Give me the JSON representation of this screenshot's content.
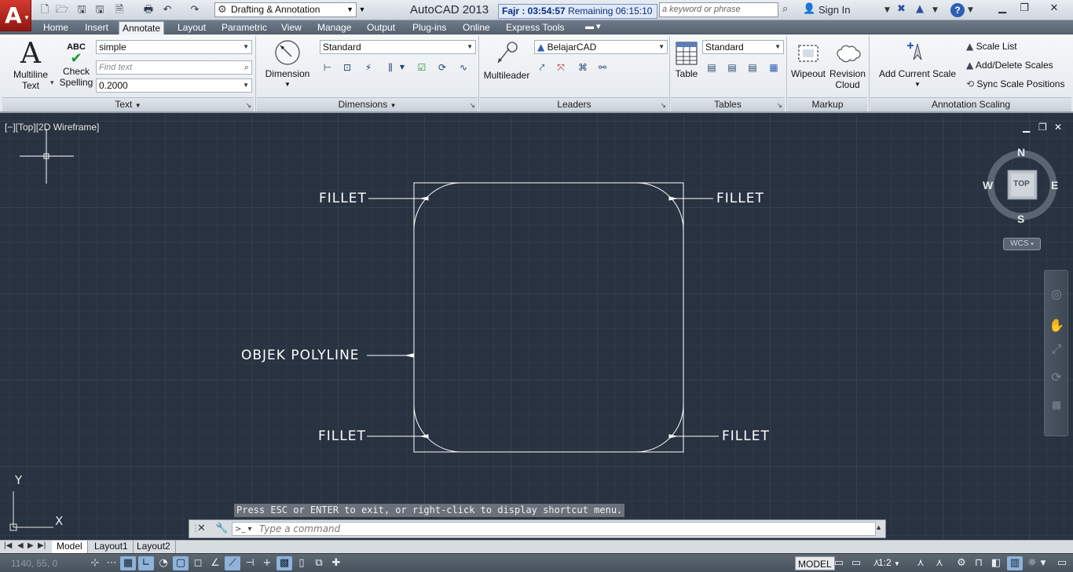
{
  "titlebar": {
    "app_title": "AutoCAD 2013",
    "workspace": "Drafting & Annotation",
    "prayer_label": "Fajr : 03:54:57",
    "prayer_remaining": "Remaining 06:15:10",
    "search_placeholder": "a keyword or phrase",
    "signin": "Sign In",
    "help_label": "?"
  },
  "tabs": [
    "Home",
    "Insert",
    "Annotate",
    "Layout",
    "Parametric",
    "View",
    "Manage",
    "Output",
    "Plug-ins",
    "Online",
    "Express Tools"
  ],
  "active_tab": "Annotate",
  "ribbon": {
    "text_panel": {
      "multiline_text": [
        "Multiline",
        "Text"
      ],
      "check_spelling": [
        "Check",
        "Spelling"
      ],
      "abc": "ABC",
      "text_style": "simple",
      "find_placeholder": "Find text",
      "text_height": "0.2000",
      "footer": "Text"
    },
    "dimensions_panel": {
      "dimension": "Dimension",
      "dim_style": "Standard",
      "footer": "Dimensions"
    },
    "leaders_panel": {
      "multileader": "Multileader",
      "leader_style": "BelajarCAD",
      "footer": "Leaders"
    },
    "tables_panel": {
      "table": "Table",
      "table_style": "Standard",
      "footer": "Tables"
    },
    "markup_panel": {
      "wipeout": "Wipeout",
      "revision_cloud": [
        "Revision",
        "Cloud"
      ],
      "footer": "Markup"
    },
    "annotation_scaling_panel": {
      "add_current_scale": "Add Current Scale",
      "scale_list": "Scale List",
      "add_delete_scales": "Add/Delete Scales",
      "sync_scale_positions": "Sync Scale Positions",
      "footer": "Annotation Scaling"
    }
  },
  "viewport": {
    "label": "[−][Top][2D Wireframe]",
    "labels": {
      "fillet_tl": "FILLET",
      "fillet_tr": "FILLET",
      "fillet_bl": "FILLET",
      "fillet_br": "FILLET",
      "polyline": "OBJEK POLYLINE"
    },
    "viewcube": {
      "n": "N",
      "s": "S",
      "e": "E",
      "w": "W",
      "top": "TOP",
      "wcs": "WCS"
    },
    "ucs": {
      "x": "X",
      "y": "Y"
    }
  },
  "command": {
    "message": "Press ESC or ENTER to exit, or right-click to display shortcut menu.",
    "placeholder": "Type a command"
  },
  "layout_tabs": [
    "Model",
    "Layout1",
    "Layout2"
  ],
  "active_layout": "Model",
  "statusbar": {
    "coords": "1140, 55, 0",
    "model": "MODEL",
    "scale": "1:2"
  },
  "colors": {
    "canvas_bg": "#283240",
    "app_red": "#c0281c",
    "ribbon_bg": "#eef2f6"
  }
}
